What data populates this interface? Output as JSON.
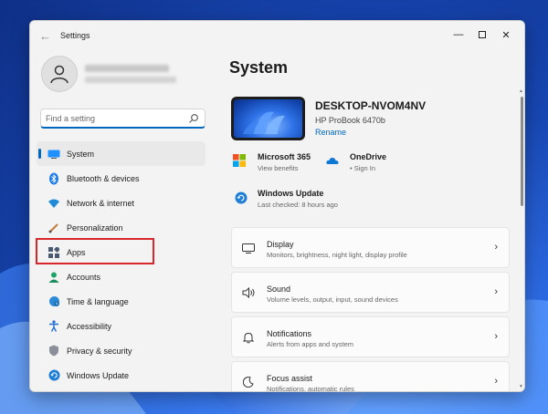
{
  "window": {
    "title": "Settings"
  },
  "search": {
    "placeholder": "Find a setting"
  },
  "sidebar": {
    "items": [
      {
        "label": "System",
        "icon": "display-icon"
      },
      {
        "label": "Bluetooth & devices",
        "icon": "bluetooth-icon"
      },
      {
        "label": "Network & internet",
        "icon": "wifi-icon"
      },
      {
        "label": "Personalization",
        "icon": "brush-icon"
      },
      {
        "label": "Apps",
        "icon": "apps-icon"
      },
      {
        "label": "Accounts",
        "icon": "person-icon"
      },
      {
        "label": "Time & language",
        "icon": "globe-clock-icon"
      },
      {
        "label": "Accessibility",
        "icon": "accessibility-icon"
      },
      {
        "label": "Privacy & security",
        "icon": "shield-icon"
      },
      {
        "label": "Windows Update",
        "icon": "update-icon"
      }
    ],
    "active": "System",
    "highlighted": "Apps"
  },
  "main": {
    "title": "System",
    "device": {
      "name": "DESKTOP-NVOM4NV",
      "model": "HP ProBook 6470b",
      "rename": "Rename"
    },
    "quick": {
      "microsoft365": {
        "title": "Microsoft 365",
        "sub": "View benefits"
      },
      "onedrive": {
        "title": "OneDrive",
        "sub": "• Sign In"
      },
      "update": {
        "title": "Windows Update",
        "sub": "Last checked: 8 hours ago"
      }
    },
    "settings": [
      {
        "title": "Display",
        "desc": "Monitors, brightness, night light, display profile",
        "icon": "monitor-icon"
      },
      {
        "title": "Sound",
        "desc": "Volume levels, output, input, sound devices",
        "icon": "speaker-icon"
      },
      {
        "title": "Notifications",
        "desc": "Alerts from apps and system",
        "icon": "bell-icon"
      },
      {
        "title": "Focus assist",
        "desc": "Notifications, automatic rules",
        "icon": "moon-icon"
      }
    ]
  },
  "colors": {
    "accent": "#0067c0",
    "highlight": "#d9262c",
    "window": "#f3f3f3"
  }
}
